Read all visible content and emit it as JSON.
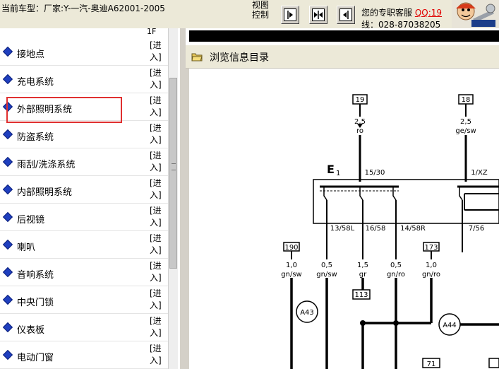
{
  "header": {
    "car_model": "当前车型：厂家:Y-一汽-奥迪A62001-2005",
    "view_control_line1": "视图",
    "view_control_line2": "控制",
    "service_line1": "您的专职客服",
    "qq": "QQ:19",
    "service_line2": "线：028-87038205",
    "nav_buttons": [
      "forward-icon",
      "split-icon",
      "back-icon"
    ]
  },
  "sidebar": {
    "top_fragment": "1F",
    "enter_label_1": "[进",
    "enter_label_2": "入]",
    "items": [
      {
        "label": "接地点"
      },
      {
        "label": "充电系统"
      },
      {
        "label": "外部照明系统"
      },
      {
        "label": "防盗系统"
      },
      {
        "label": "雨刮/洗涤系统"
      },
      {
        "label": "内部照明系统"
      },
      {
        "label": "后视镜"
      },
      {
        "label": "喇叭"
      },
      {
        "label": "音响系统"
      },
      {
        "label": "中央门锁"
      },
      {
        "label": "仪表板"
      },
      {
        "label": "电动门窗"
      }
    ],
    "highlighted_index": 2,
    "highlight_color": "#e03030"
  },
  "content": {
    "browse_label": "浏览信息目录"
  },
  "diagram": {
    "connector_19": "19",
    "connector_18": "18",
    "wire_19_size": "2,5",
    "wire_19_color": "ro",
    "wire_18_size": "2,5",
    "wire_18_color": "ge/sw",
    "component": "E",
    "component_sub": "1",
    "pin_15_30": "15/30",
    "pin_1_xz": "1/XZ",
    "pin_13_58l": "13/58L",
    "pin_16_58": "16/58",
    "pin_14_58r": "14/58R",
    "pin_7_56": "7/56",
    "connector_190": "190",
    "connector_173": "173",
    "wire_a_size": "1,0",
    "wire_a_color": "gn/sw",
    "wire_b_size": "0,5",
    "wire_b_color": "gn/sw",
    "wire_c_size": "1,5",
    "wire_c_color": "gr",
    "wire_d_size": "0,5",
    "wire_d_color": "gn/ro",
    "wire_e_size": "1,0",
    "wire_e_color": "gn/ro",
    "connector_113": "113",
    "ground_a43": "A43",
    "ground_a44": "A44",
    "connector_71": "71"
  }
}
